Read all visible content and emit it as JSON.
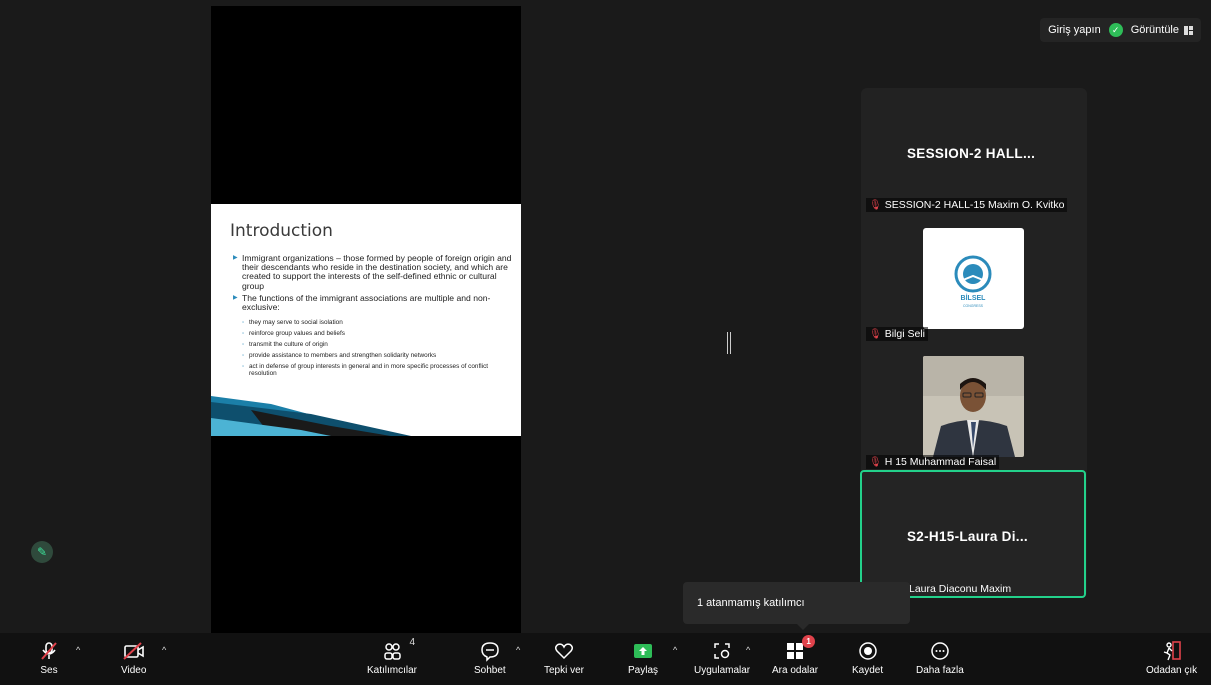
{
  "topbar": {
    "signin_label": "Giriş yapın",
    "view_label": "Görüntüle"
  },
  "slide": {
    "title": "Introduction",
    "bullets": [
      "Immigrant organizations – those formed by people of foreign origin and their descendants who reside in the destination society, and which are created to support the interests of the self-defined ethnic or cultural group",
      "The functions of the immigrant associations are multiple and non-exclusive:"
    ],
    "subbullets": [
      "they may serve to social isolation",
      "reinforce group values and beliefs",
      "transmit the culture of origin",
      "provide assistance to members and strengthen solidarity networks",
      "act in defense of group interests in general and in more specific processes of conflict resolution"
    ]
  },
  "participants": [
    {
      "tile_title": "SESSION-2  HALL...",
      "name": "SESSION-2 HALL-15 Maxim O. Kvitko"
    },
    {
      "logo_text": "BİLSEL",
      "logo_sub": "CONGRESS",
      "name": "Bilgi Seli"
    },
    {
      "name": "H 15 Muhammad Faisal"
    },
    {
      "tile_title": "S2-H15-Laura  Di...",
      "name": "Laura Diaconu Maxim"
    }
  ],
  "tooltip": {
    "text": "1 atanmamış katılımcı"
  },
  "toolbar": {
    "audio": "Ses",
    "video": "Video",
    "participants": "Katılımcılar",
    "participants_count": "4",
    "chat": "Sohbet",
    "react": "Tepki ver",
    "share": "Paylaş",
    "apps": "Uygulamalar",
    "breakout": "Ara odalar",
    "breakout_badge": "1",
    "record": "Kaydet",
    "more": "Daha fazla",
    "leave": "Odadan çık"
  },
  "colors": {
    "accent": "#23d18b",
    "muted_red": "#e0424b",
    "share_green": "#2ebd58"
  }
}
